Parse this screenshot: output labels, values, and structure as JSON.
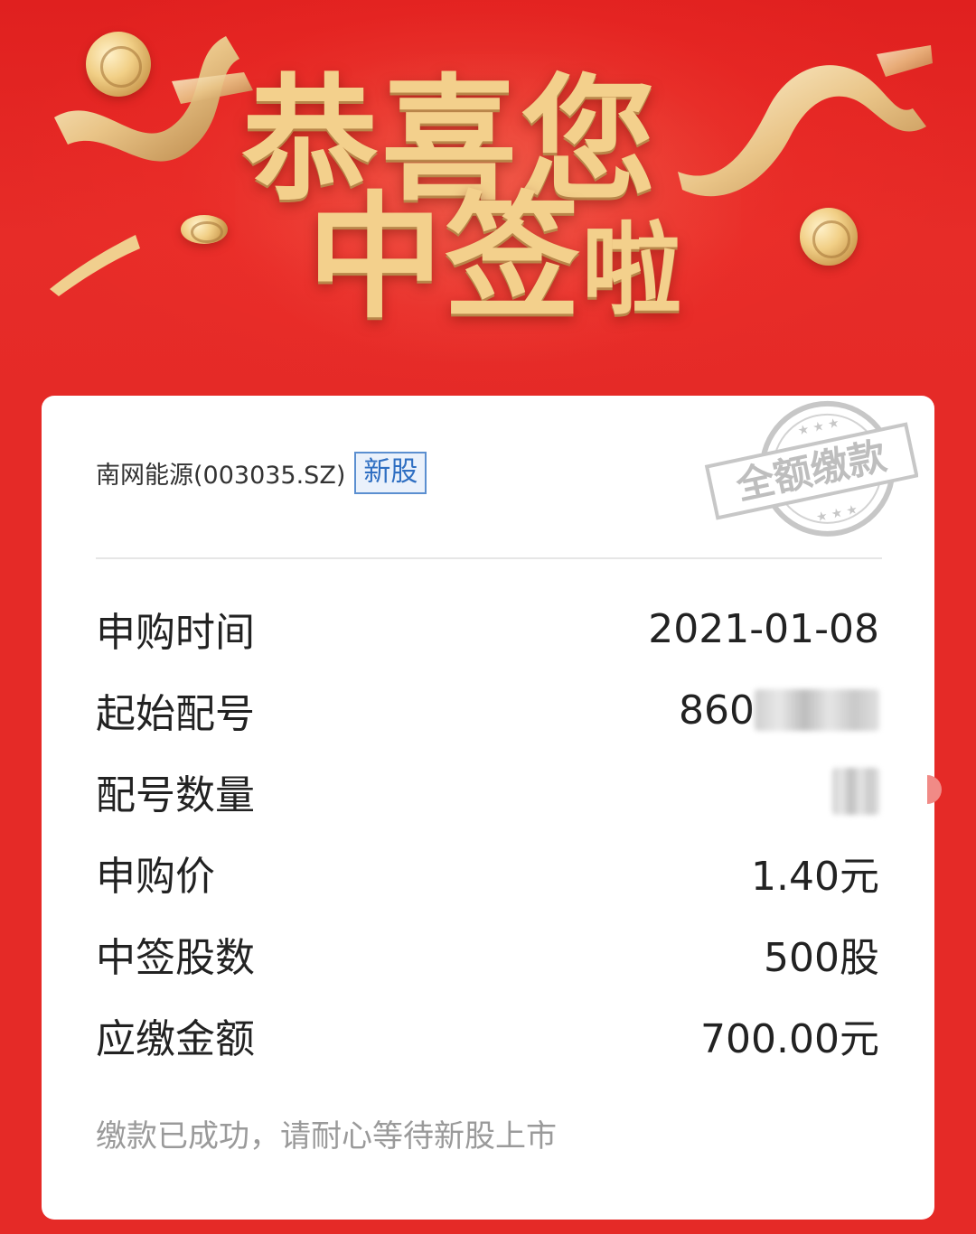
{
  "banner": {
    "headline_line1": "恭喜您",
    "headline_line2_main": "中签",
    "headline_line2_small": "啦"
  },
  "stock": {
    "name": "南网能源(003035.SZ)",
    "badge": "新股"
  },
  "stamp": {
    "text": "全额缴款"
  },
  "details": [
    {
      "label": "申购时间",
      "value": "2021-01-08"
    },
    {
      "label": "起始配号",
      "value": "860"
    },
    {
      "label": "配号数量",
      "value": ""
    },
    {
      "label": "申购价",
      "value": "1.40元"
    },
    {
      "label": "中签股数",
      "value": "500股"
    },
    {
      "label": "应缴金额",
      "value": "700.00元"
    }
  ],
  "note": "缴款已成功，请耐心等待新股上市",
  "colors": {
    "background_red": "#e52a27",
    "headline_gold": "#f3d08c",
    "badge_blue": "#2f6fc2",
    "note_gray": "#9a9a9a"
  }
}
